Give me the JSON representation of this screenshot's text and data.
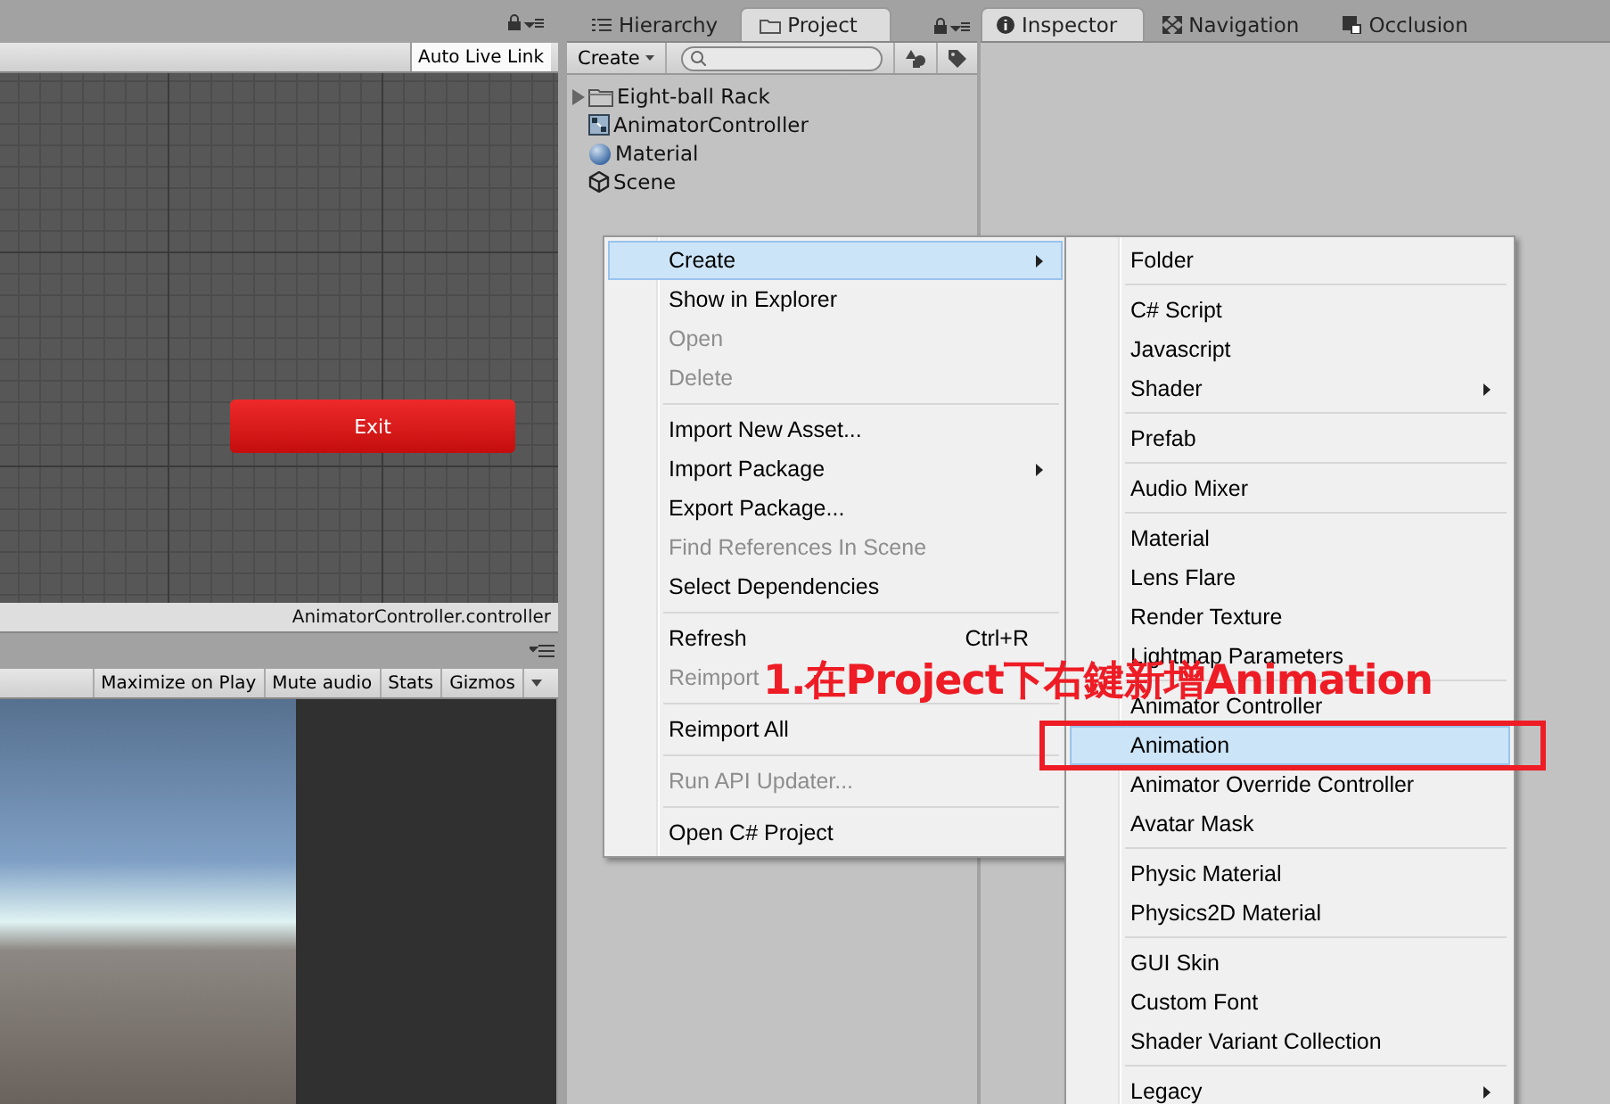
{
  "animator_panel": {
    "auto_live_link": "Auto Live Link",
    "exit_state": "Exit",
    "footer": "AnimatorController.controller"
  },
  "game_panel": {
    "toolbar": [
      "Maximize on Play",
      "Mute audio",
      "Stats",
      "Gizmos"
    ]
  },
  "project_panel": {
    "tabs": [
      {
        "label": "Hierarchy",
        "selected": false,
        "kind": "list"
      },
      {
        "label": "Project",
        "selected": true,
        "kind": "folder"
      }
    ],
    "create_button": "Create",
    "assets": [
      {
        "label": "Eight-ball Rack",
        "kind": "folder"
      },
      {
        "label": "AnimatorController",
        "kind": "controller"
      },
      {
        "label": "Material",
        "kind": "material"
      },
      {
        "label": "Scene",
        "kind": "scene"
      }
    ]
  },
  "inspector_panel": {
    "tabs": [
      {
        "label": "Inspector",
        "selected": true,
        "kind": "info"
      },
      {
        "label": "Navigation",
        "selected": false,
        "kind": "navigation"
      },
      {
        "label": "Occlusion",
        "selected": false,
        "kind": "occlusion"
      }
    ]
  },
  "context_menu": {
    "items": [
      {
        "kind": "item",
        "label": "Create",
        "disabled": false,
        "selected": true,
        "submenu": true
      },
      {
        "kind": "item",
        "label": "Show in Explorer",
        "disabled": false,
        "selected": false
      },
      {
        "kind": "item",
        "label": "Open",
        "disabled": true,
        "selected": false
      },
      {
        "kind": "item",
        "label": "Delete",
        "disabled": true,
        "selected": false
      },
      {
        "kind": "separator"
      },
      {
        "kind": "item",
        "label": "Import New Asset...",
        "disabled": false,
        "selected": false
      },
      {
        "kind": "item",
        "label": "Import Package",
        "disabled": false,
        "selected": false,
        "submenu": true
      },
      {
        "kind": "item",
        "label": "Export Package...",
        "disabled": false,
        "selected": false
      },
      {
        "kind": "item",
        "label": "Find References In Scene",
        "disabled": true,
        "selected": false
      },
      {
        "kind": "item",
        "label": "Select Dependencies",
        "disabled": false,
        "selected": false
      },
      {
        "kind": "separator"
      },
      {
        "kind": "item",
        "label": "Refresh",
        "shortcut": "Ctrl+R",
        "disabled": false,
        "selected": false
      },
      {
        "kind": "item",
        "label": "Reimport",
        "disabled": true,
        "selected": false
      },
      {
        "kind": "separator"
      },
      {
        "kind": "item",
        "label": "Reimport All",
        "disabled": false,
        "selected": false
      },
      {
        "kind": "separator"
      },
      {
        "kind": "item",
        "label": "Run API Updater...",
        "disabled": true,
        "selected": false
      },
      {
        "kind": "separator"
      },
      {
        "kind": "item",
        "label": "Open C# Project",
        "disabled": false,
        "selected": false
      }
    ]
  },
  "create_submenu": {
    "items": [
      {
        "kind": "item",
        "label": "Folder",
        "selected": false
      },
      {
        "kind": "separator"
      },
      {
        "kind": "item",
        "label": "C# Script",
        "selected": false
      },
      {
        "kind": "item",
        "label": "Javascript",
        "selected": false
      },
      {
        "kind": "item",
        "label": "Shader",
        "selected": false,
        "submenu": true
      },
      {
        "kind": "separator"
      },
      {
        "kind": "item",
        "label": "Prefab",
        "selected": false
      },
      {
        "kind": "separator"
      },
      {
        "kind": "item",
        "label": "Audio Mixer",
        "selected": false
      },
      {
        "kind": "separator"
      },
      {
        "kind": "item",
        "label": "Material",
        "selected": false
      },
      {
        "kind": "item",
        "label": "Lens Flare",
        "selected": false
      },
      {
        "kind": "item",
        "label": "Render Texture",
        "selected": false
      },
      {
        "kind": "item",
        "label": "Lightmap Parameters",
        "selected": false
      },
      {
        "kind": "separator"
      },
      {
        "kind": "item",
        "label": "Animator Controller",
        "selected": false
      },
      {
        "kind": "item",
        "label": "Animation",
        "selected": true
      },
      {
        "kind": "item",
        "label": "Animator Override Controller",
        "selected": false
      },
      {
        "kind": "item",
        "label": "Avatar Mask",
        "selected": false
      },
      {
        "kind": "separator"
      },
      {
        "kind": "item",
        "label": "Physic Material",
        "selected": false
      },
      {
        "kind": "item",
        "label": "Physics2D Material",
        "selected": false
      },
      {
        "kind": "separator"
      },
      {
        "kind": "item",
        "label": "GUI Skin",
        "selected": false
      },
      {
        "kind": "item",
        "label": "Custom Font",
        "selected": false
      },
      {
        "kind": "item",
        "label": "Shader Variant Collection",
        "selected": false
      },
      {
        "kind": "separator"
      },
      {
        "kind": "item",
        "label": "Legacy",
        "selected": false,
        "submenu": true
      }
    ]
  },
  "annotation": {
    "text": "1.在Project下右鍵新增Animation"
  }
}
